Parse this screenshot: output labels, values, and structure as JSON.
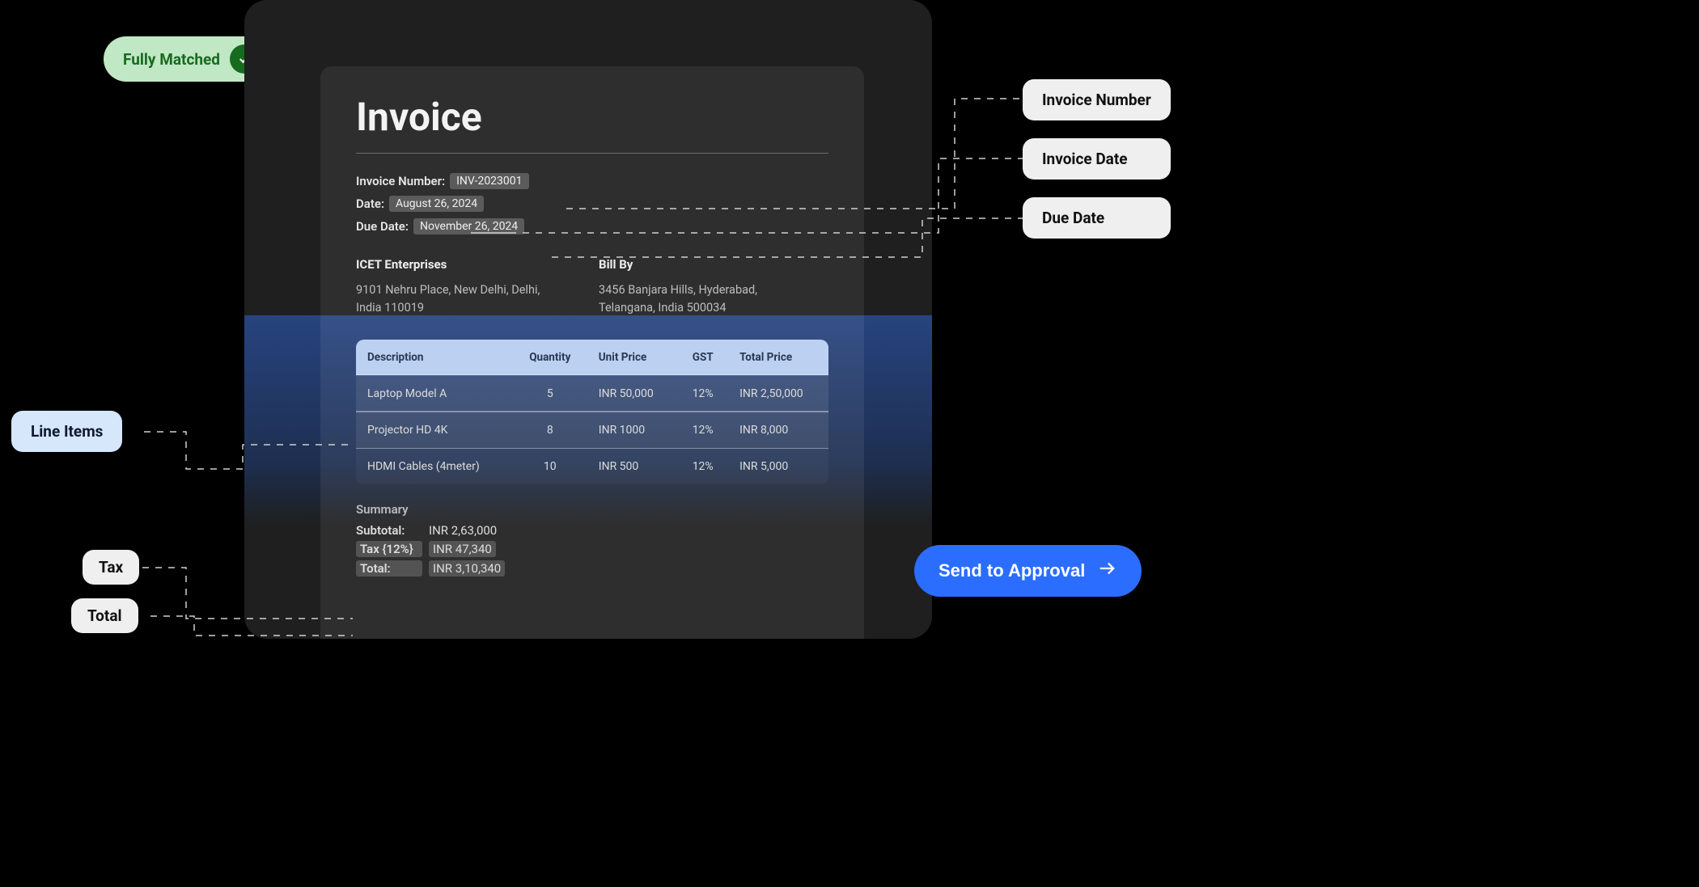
{
  "status": {
    "label": "Fully Matched"
  },
  "invoice": {
    "title": "Invoice",
    "numberLabel": "Invoice Number:",
    "numberValue": "INV-2023001",
    "dateLabel": "Date:",
    "dateValue": "August 26, 2024",
    "dueLabel": "Due Date:",
    "dueValue": "November 26, 2024"
  },
  "parties": {
    "from": {
      "name": "ICET Enterprises",
      "address": "9101 Nehru Place, New Delhi, Delhi, India 110019"
    },
    "billBy": {
      "title": "Bill By",
      "address": "3456 Banjara Hills, Hyderabad, Telangana, India 500034"
    }
  },
  "table": {
    "headers": {
      "desc": "Description",
      "qty": "Quantity",
      "unit": "Unit Price",
      "gst": "GST",
      "total": "Total Price"
    },
    "rows": [
      {
        "desc": "Laptop Model A",
        "qty": "5",
        "unit": "INR 50,000",
        "gst": "12%",
        "total": "INR 2,50,000"
      },
      {
        "desc": "Projector HD 4K",
        "qty": "8",
        "unit": "INR 1000",
        "gst": "12%",
        "total": "INR 8,000"
      },
      {
        "desc": "HDMI Cables (4meter)",
        "qty": "10",
        "unit": "INR 500",
        "gst": "12%",
        "total": "INR  5,000"
      }
    ]
  },
  "summary": {
    "title": "Summary",
    "subtotalLabel": "Subtotal:",
    "subtotalValue": "INR 2,63,000",
    "taxLabel": "Tax {12%}",
    "taxValue": "INR 47,340",
    "totalLabel": "Total:",
    "totalValue": "INR 3,10,340"
  },
  "callouts": {
    "right0": "Invoice Number",
    "right1": "Invoice Date",
    "right2": "Due Date",
    "lineItems": "Line Items",
    "tax": "Tax",
    "total": "Total"
  },
  "actions": {
    "approve": "Send to Approval"
  }
}
